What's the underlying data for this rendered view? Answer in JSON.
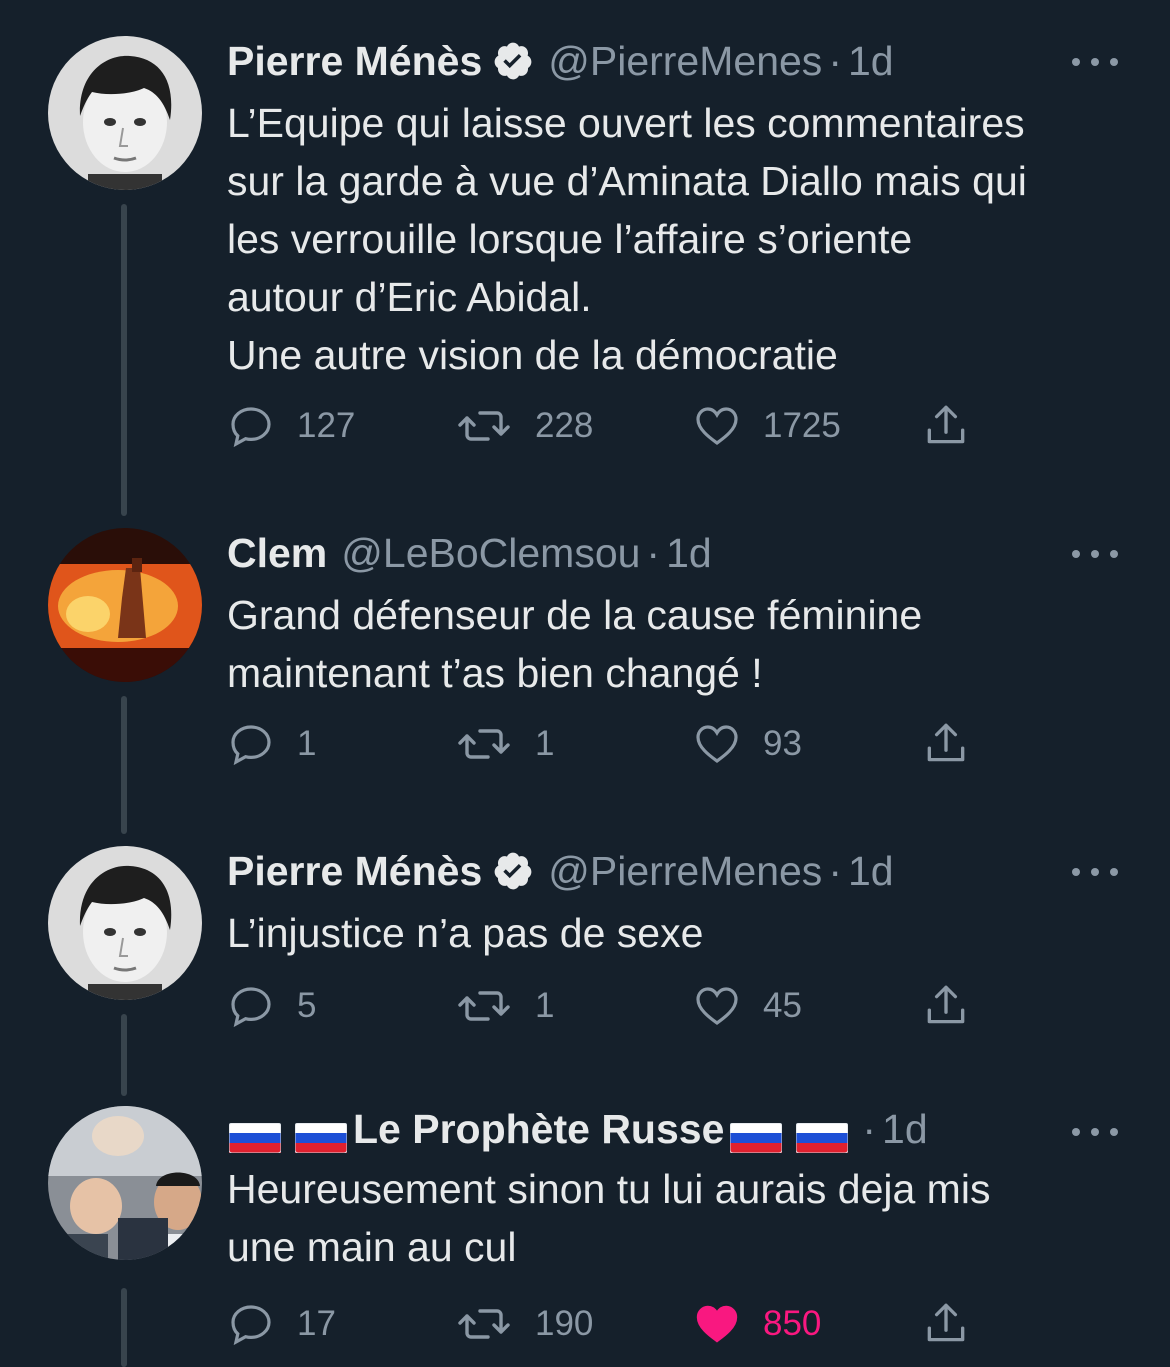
{
  "tweets": [
    {
      "name": "Pierre Ménès",
      "handle": "@PierreMenes",
      "dot": "·",
      "time": "1d",
      "text": "L’Equipe qui laisse ouvert les commentaires\nsur la garde à vue d’Aminata Diallo mais qui\nles verrouille lorsque l’affaire s’oriente\nautour d’Eric Abidal.\nUne autre vision de la démocratie",
      "replies": "127",
      "retweets": "228",
      "likes": "1725"
    },
    {
      "name": "Clem",
      "handle": "@LeBoClemsou",
      "dot": "·",
      "time": "1d",
      "text": "Grand défenseur de la cause féminine\nmaintenant t’as bien changé !",
      "replies": "1",
      "retweets": "1",
      "likes": "93"
    },
    {
      "name": "Pierre Ménès",
      "handle": "@PierreMenes",
      "dot": "·",
      "time": "1d",
      "text": "L’injustice n’a pas de sexe",
      "replies": "5",
      "retweets": "1",
      "likes": "45"
    },
    {
      "name": "Le Prophète Russe",
      "handle": "",
      "dot": "·",
      "time": "1d",
      "text": "Heureusement sinon tu lui aurais deja mis\nune main au cul",
      "replies": "17",
      "retweets": "190",
      "likes": "850",
      "liked": true
    }
  ],
  "colors": {
    "background": "#15202b",
    "text": "#e7e9ea",
    "muted": "#8b98a5",
    "thread_line": "#38444d",
    "like_active": "#f91880"
  },
  "icons": [
    "verified-badge-icon",
    "more-icon",
    "reply-icon",
    "retweet-icon",
    "like-icon",
    "share-icon",
    "russia-flag-icon"
  ]
}
